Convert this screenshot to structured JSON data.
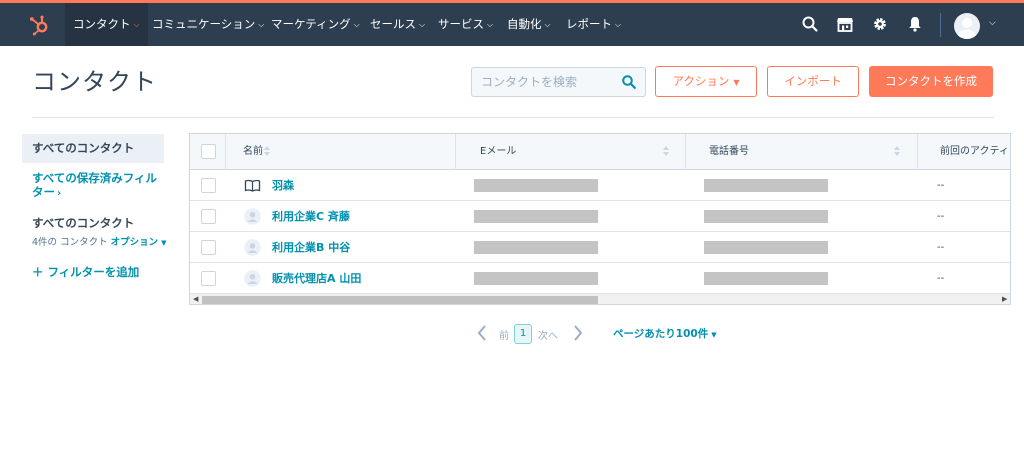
{
  "nav": {
    "items": [
      {
        "label": "コンタクト",
        "active": true
      },
      {
        "label": "コミュニケーション"
      },
      {
        "label": "マーケティング"
      },
      {
        "label": "セールス"
      },
      {
        "label": "サービス"
      },
      {
        "label": "自動化"
      },
      {
        "label": "レポート"
      }
    ],
    "icons": [
      "search-icon",
      "marketplace-icon",
      "settings-gear-icon",
      "notifications-bell-icon"
    ]
  },
  "header": {
    "title": "コンタクト",
    "search_placeholder": "コンタクトを検索",
    "actions_label": "アクション",
    "import_label": "インポート",
    "create_label": "コンタクトを作成"
  },
  "sidebar": {
    "active_view": "すべてのコンタクト",
    "saved_filters_link": "すべての保存済みフィルター",
    "view_heading": "すべてのコンタクト",
    "count_text": "4件の コンタクト",
    "options_label": "オプション",
    "add_filter_label": "フィルターを追加"
  },
  "table": {
    "columns": [
      "名前",
      "Eメール",
      "電話番号",
      "前回のアクティビ"
    ],
    "rows": [
      {
        "name": "羽森",
        "icon": "book-icon",
        "last_activity": "--"
      },
      {
        "name": "利用企業C 斉藤",
        "icon": "avatar-icon",
        "last_activity": "--"
      },
      {
        "name": "利用企業B 中谷",
        "icon": "avatar-icon",
        "last_activity": "--"
      },
      {
        "name": "販売代理店A 山田",
        "icon": "avatar-icon",
        "last_activity": "--"
      }
    ]
  },
  "pagination": {
    "prev_label": "前",
    "current_page": "1",
    "next_label": "次へ",
    "per_page_label": "ページあたり100件"
  },
  "colors": {
    "nav_bg": "#2d3e50",
    "accent": "#ff7a59",
    "link": "#0091ae",
    "text": "#33475b"
  }
}
